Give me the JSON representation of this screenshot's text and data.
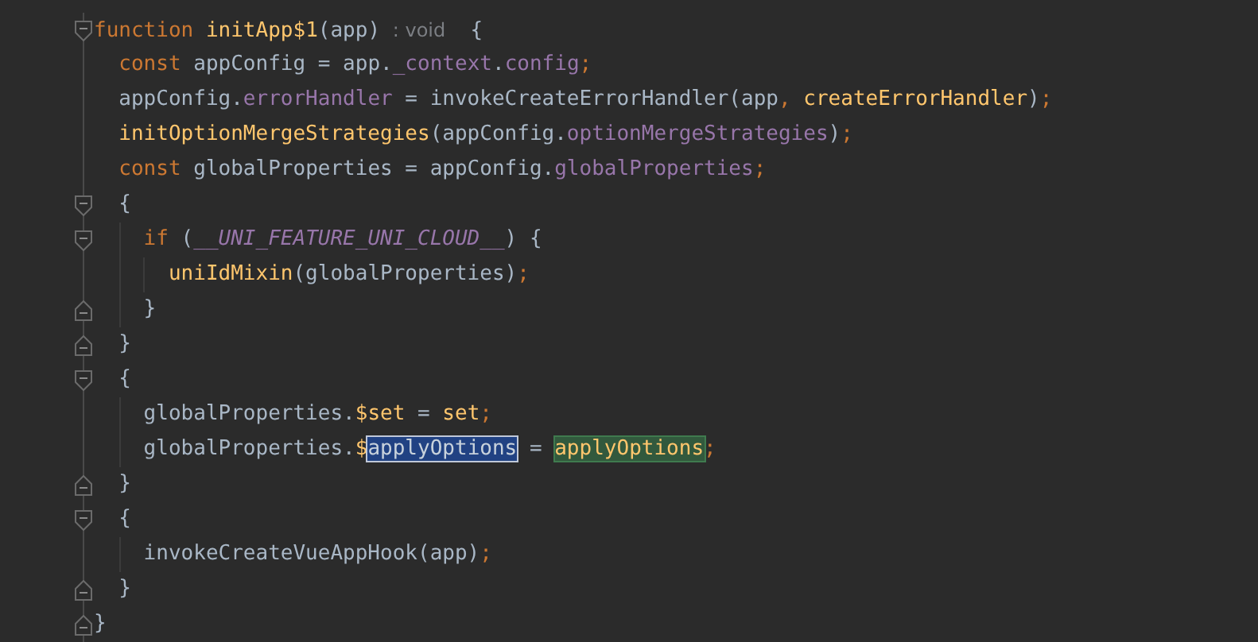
{
  "editor": {
    "lines": [
      {
        "kind": "fold_start",
        "tokens": [
          {
            "t": "function ",
            "kind": "kw"
          },
          {
            "t": "initApp$1",
            "kind": "fn"
          },
          {
            "t": "(app) ",
            "kind": "plain"
          },
          {
            "t": ": void",
            "kind": "hint"
          },
          {
            "t": "  {",
            "kind": "plain"
          }
        ]
      },
      {
        "kind": "code",
        "tokens": [
          {
            "t": "  const ",
            "kind": "kw"
          },
          {
            "t": "appConfig = app.",
            "kind": "plain"
          },
          {
            "t": "_context",
            "kind": "field"
          },
          {
            "t": ".",
            "kind": "plain"
          },
          {
            "t": "config",
            "kind": "field"
          },
          {
            "t": ";",
            "kind": "punct"
          }
        ]
      },
      {
        "kind": "code",
        "tokens": [
          {
            "t": "  appConfig.",
            "kind": "plain"
          },
          {
            "t": "errorHandler",
            "kind": "field"
          },
          {
            "t": " = invokeCreateErrorHandler(app",
            "kind": "plain"
          },
          {
            "t": ", ",
            "kind": "punct"
          },
          {
            "t": "createErrorHandler",
            "kind": "fn"
          },
          {
            "t": ")",
            "kind": "plain"
          },
          {
            "t": ";",
            "kind": "punct"
          }
        ]
      },
      {
        "kind": "code",
        "tokens": [
          {
            "t": "  initOptionMergeStrategies",
            "kind": "fn"
          },
          {
            "t": "(appConfig.",
            "kind": "plain"
          },
          {
            "t": "optionMergeStrategies",
            "kind": "field"
          },
          {
            "t": ")",
            "kind": "plain"
          },
          {
            "t": ";",
            "kind": "punct"
          }
        ]
      },
      {
        "kind": "code",
        "tokens": [
          {
            "t": "  const ",
            "kind": "kw"
          },
          {
            "t": "globalProperties = appConfig.",
            "kind": "plain"
          },
          {
            "t": "globalProperties",
            "kind": "field"
          },
          {
            "t": ";",
            "kind": "punct"
          }
        ]
      },
      {
        "kind": "fold_start",
        "tokens": [
          {
            "t": "  {",
            "kind": "plain"
          }
        ]
      },
      {
        "kind": "fold_start",
        "tokens": [
          {
            "t": "    if ",
            "kind": "kw"
          },
          {
            "t": "(",
            "kind": "plain"
          },
          {
            "t": "__UNI_FEATURE_UNI_CLOUD__",
            "kind": "const"
          },
          {
            "t": ") {",
            "kind": "plain"
          }
        ]
      },
      {
        "kind": "code",
        "tokens": [
          {
            "t": "      uniIdMixin",
            "kind": "fn"
          },
          {
            "t": "(globalProperties)",
            "kind": "plain"
          },
          {
            "t": ";",
            "kind": "punct"
          }
        ]
      },
      {
        "kind": "fold_end",
        "tokens": [
          {
            "t": "    }",
            "kind": "plain"
          }
        ]
      },
      {
        "kind": "fold_end",
        "tokens": [
          {
            "t": "  }",
            "kind": "plain"
          }
        ]
      },
      {
        "kind": "fold_start",
        "tokens": [
          {
            "t": "  {",
            "kind": "plain"
          }
        ]
      },
      {
        "kind": "code",
        "tokens": [
          {
            "t": "    globalProperties.",
            "kind": "plain"
          },
          {
            "t": "$set",
            "kind": "fn"
          },
          {
            "t": " = ",
            "kind": "plain"
          },
          {
            "t": "set",
            "kind": "fn"
          },
          {
            "t": ";",
            "kind": "punct"
          }
        ]
      },
      {
        "kind": "code",
        "tokens": [
          {
            "t": "    globalProperties.",
            "kind": "plain"
          },
          {
            "t": "$",
            "kind": "fn"
          },
          {
            "t": "applyOptions",
            "kind": "selection"
          },
          {
            "t": " = ",
            "kind": "plain"
          },
          {
            "t": "applyOptions",
            "kind": "match"
          },
          {
            "t": ";",
            "kind": "punct"
          }
        ]
      },
      {
        "kind": "fold_end",
        "tokens": [
          {
            "t": "  }",
            "kind": "plain"
          }
        ]
      },
      {
        "kind": "fold_start",
        "tokens": [
          {
            "t": "  {",
            "kind": "plain"
          }
        ]
      },
      {
        "kind": "code",
        "tokens": [
          {
            "t": "    invokeCreateVueAppHook(app)",
            "kind": "plain"
          },
          {
            "t": ";",
            "kind": "punct"
          }
        ]
      },
      {
        "kind": "fold_end",
        "tokens": [
          {
            "t": "  }",
            "kind": "plain"
          }
        ]
      },
      {
        "kind": "fold_end",
        "tokens": [
          {
            "t": "}",
            "kind": "plain"
          }
        ]
      }
    ]
  }
}
